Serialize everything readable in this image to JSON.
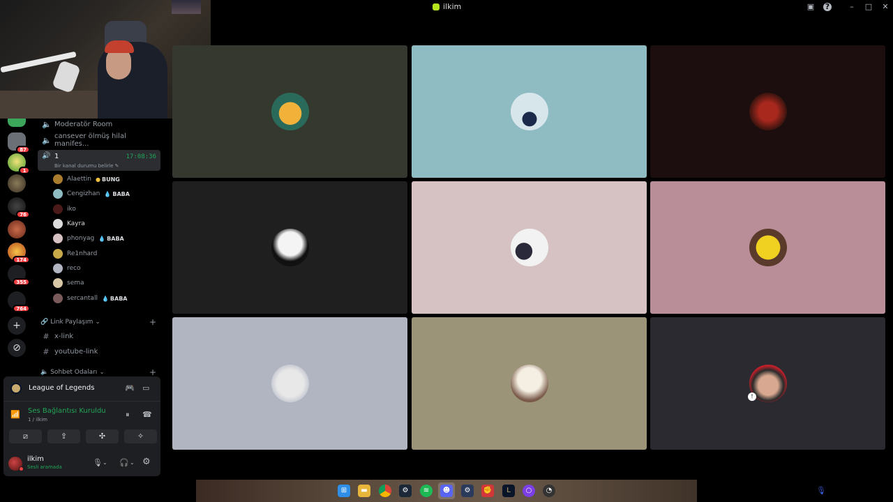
{
  "window": {
    "title": "ilkim"
  },
  "colors": {
    "accent_green": "#23a55a",
    "badge_red": "#f23f42"
  },
  "servers": {
    "badges": [
      "87",
      "1",
      "76",
      "174",
      "355",
      "764"
    ]
  },
  "channels": {
    "moderator": "Moderatör Room",
    "cansever": "cansever ölmüş hilal manifes...",
    "active": {
      "name": "1",
      "time": "17:08:36",
      "status": "Bir kanal durumu belirle"
    },
    "users": [
      {
        "name": "Alaettin",
        "tag": "BUNG"
      },
      {
        "name": "Cengizhan",
        "tag": "BABA"
      },
      {
        "name": "iko",
        "tag": ""
      },
      {
        "name": "Kayra",
        "tag": ""
      },
      {
        "name": "phonyag",
        "tag": "BABA"
      },
      {
        "name": "Re1nhard",
        "tag": ""
      },
      {
        "name": "reco",
        "tag": ""
      },
      {
        "name": "sema",
        "tag": ""
      },
      {
        "name": "sercantall",
        "tag": "BABA"
      }
    ],
    "link_category": "Link Paylaşım",
    "x_link": "x-link",
    "youtube_link": "youtube-link",
    "chat_category": "Sohbet Odaları"
  },
  "activity": {
    "game": "League of Legends"
  },
  "voice": {
    "state": "Ses Bağlantısı Kuruldu",
    "sub": "1 / ilkim"
  },
  "me": {
    "name": "ilkim",
    "status": "Sesli aramada"
  },
  "grid": {
    "tile_colors": [
      "#35382f",
      "#8fbcc3",
      "#1c0e0e",
      "#1f1f1f",
      "#d6c2c2",
      "#b98e98",
      "#b1b5c2",
      "#9b9478",
      "#2b2a30"
    ]
  }
}
